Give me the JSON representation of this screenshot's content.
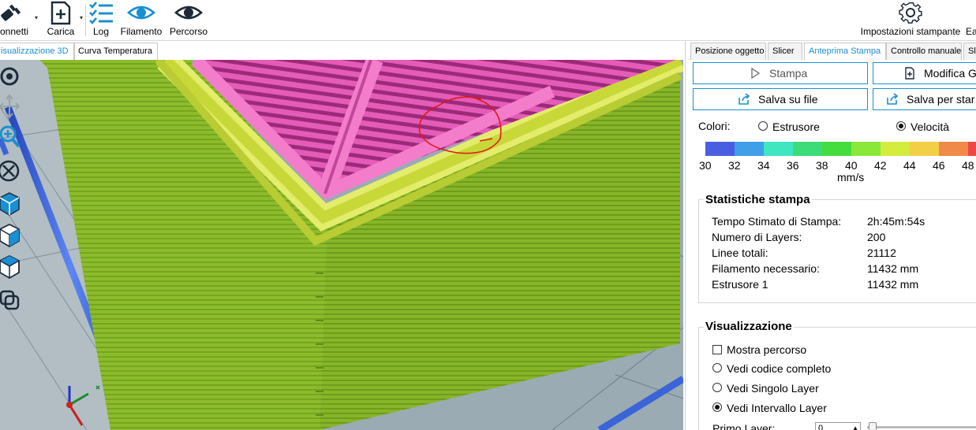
{
  "toolbar": {
    "connect_label": "onnetti",
    "load_label": "Carica",
    "log_label": "Log",
    "filament_label": "Filamento",
    "path_label": "Percorso",
    "printer_settings_label": "Impostazioni stampante",
    "extra_label": "Ea"
  },
  "view_tabs": [
    "isualizzazione 3D",
    "Curva Temperatura"
  ],
  "right_tabs": [
    "Posizione oggetto",
    "Slicer",
    "Anteprima Stampa",
    "Controllo manuale",
    "Sl"
  ],
  "buttons": {
    "print": "Stampa",
    "edit": "Modifica G",
    "save_file": "Salva su file",
    "save_print": "Salva per star"
  },
  "colors": {
    "label": "Colori:",
    "extruder": "Estrusore",
    "speed": "Velocità",
    "scale_ticks": [
      "30",
      "32",
      "34",
      "36",
      "38",
      "40",
      "42",
      "44",
      "46",
      "48"
    ],
    "unit": "mm/s",
    "swatches": [
      "#4a5fe0",
      "#3f9fe8",
      "#3fe6c0",
      "#3cdc78",
      "#45dc40",
      "#8ae83a",
      "#d4ec3e",
      "#f2cf46",
      "#f08a48",
      "#ec4848"
    ]
  },
  "stats": {
    "title": "Statistiche stampa",
    "rows": [
      {
        "label": "Tempo Stimato di Stampa:",
        "value": "2h:45m:54s"
      },
      {
        "label": "Numero di Layers:",
        "value": "200"
      },
      {
        "label": "Linee totali:",
        "value": "21112"
      },
      {
        "label": "Filamento necessario:",
        "value": "11432 mm"
      },
      {
        "label": "Estrusore 1",
        "value": "11432 mm"
      }
    ]
  },
  "visualization": {
    "title": "Visualizzazione",
    "show_path": "Mostra percorso",
    "full_code": "Vedi codice completo",
    "single_layer": "Vedi Singolo Layer",
    "layer_range": "Vedi Intervallo Layer",
    "first_layer": "Primo Layer:",
    "first_layer_value": "0"
  }
}
